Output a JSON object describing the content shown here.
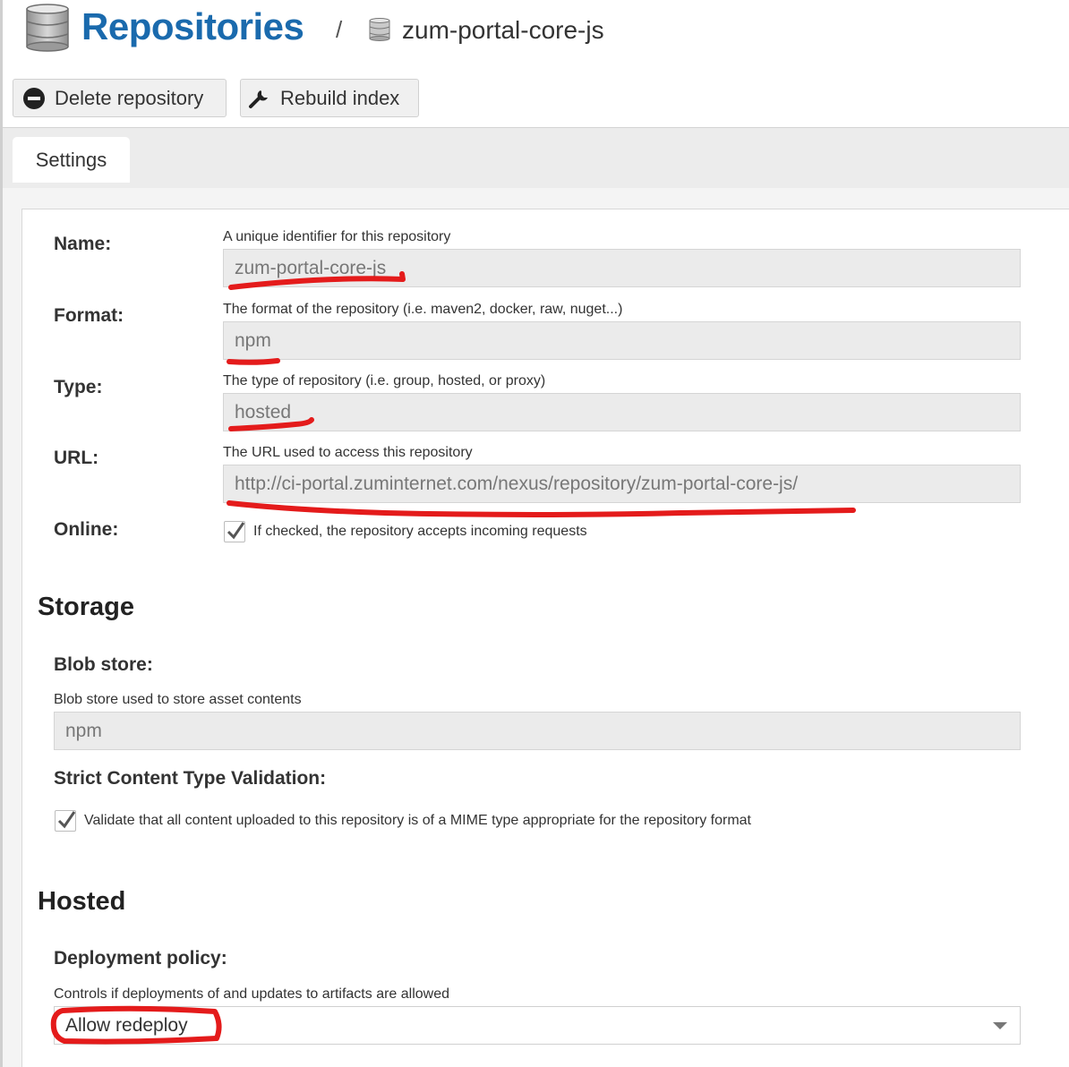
{
  "header": {
    "title": "Repositories",
    "separator": "/",
    "repo_name": "zum-portal-core-js"
  },
  "toolbar": {
    "delete_label": "Delete repository",
    "rebuild_label": "Rebuild index"
  },
  "tabs": [
    {
      "label": "Settings",
      "active": true
    }
  ],
  "form": {
    "name": {
      "label": "Name:",
      "help": "A unique identifier for this repository",
      "value": "zum-portal-core-js"
    },
    "format": {
      "label": "Format:",
      "help": "The format of the repository (i.e. maven2, docker, raw, nuget...)",
      "value": "npm"
    },
    "type": {
      "label": "Type:",
      "help": "The type of repository (i.e. group, hosted, or proxy)",
      "value": "hosted"
    },
    "url": {
      "label": "URL:",
      "help": "The URL used to access this repository",
      "value": "http://ci-portal.zuminternet.com/nexus/repository/zum-portal-core-js/"
    },
    "online": {
      "label": "Online:",
      "checked": true,
      "checkbox_label": "If checked, the repository accepts incoming requests"
    }
  },
  "storage": {
    "heading": "Storage",
    "blob_store": {
      "label": "Blob store:",
      "help": "Blob store used to store asset contents",
      "value": "npm"
    },
    "strict": {
      "label": "Strict Content Type Validation:",
      "checked": true,
      "checkbox_label": "Validate that all content uploaded to this repository is of a MIME type appropriate for the repository format"
    }
  },
  "hosted": {
    "heading": "Hosted",
    "deployment": {
      "label": "Deployment policy:",
      "help": "Controls if deployments of and updates to artifacts are allowed",
      "value": "Allow redeploy"
    }
  },
  "colors": {
    "title_blue": "#1a6aad",
    "annotation_red": "#e41b1b",
    "field_bg": "#ebebeb"
  },
  "icons": {
    "header": "database-icon",
    "breadcrumb": "database-icon",
    "delete": "minus-circle-icon",
    "rebuild": "wrench-icon",
    "checkbox": "checkmark-icon",
    "select": "caret-down-icon"
  }
}
